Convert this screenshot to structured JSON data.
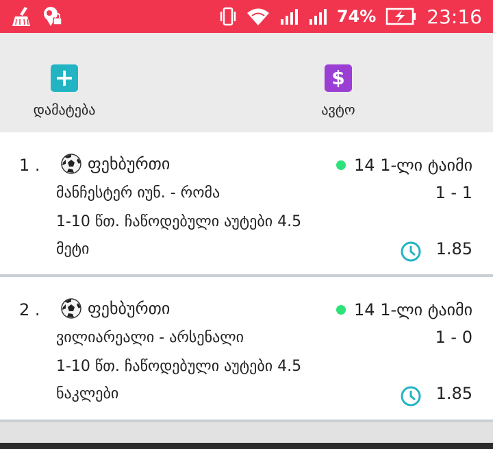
{
  "status_bar": {
    "battery_percent": "74%",
    "time": "23:16",
    "icons": [
      "cleaner-broom-icon",
      "location-lock-icon",
      "vibrate-icon",
      "wifi-icon",
      "signal-icon",
      "signal-icon",
      "battery-charging-icon"
    ]
  },
  "actions": [
    {
      "label": "დამატება",
      "icon": "plus-icon",
      "color": "#23b4c4"
    },
    {
      "label": "ავტო",
      "icon": "dollar-icon",
      "color": "#9b3fd4"
    }
  ],
  "bets": [
    {
      "number": "1 .",
      "sport": "ფეხბურთი",
      "status": "14 1-ლი ტაიმი",
      "teams": "მანჩესტერ იუნ. - რომა",
      "score": "1 - 1",
      "market": "1-10 წთ. ჩაწოდებული აუტები 4.5",
      "selection": "მეტი",
      "odds": "1.85"
    },
    {
      "number": "2 .",
      "sport": "ფეხბურთი",
      "status": "14 1-ლი ტაიმი",
      "teams": "ვილიარეალი - არსენალი",
      "score": "1 - 0",
      "market": "1-10 წთ. ჩაწოდებული აუტები 4.5",
      "selection": "ნაკლები",
      "odds": "1.85"
    }
  ],
  "colors": {
    "status_bar": "#f2354f",
    "live_dot": "#2ee27a",
    "clock": "#23b4c4"
  }
}
